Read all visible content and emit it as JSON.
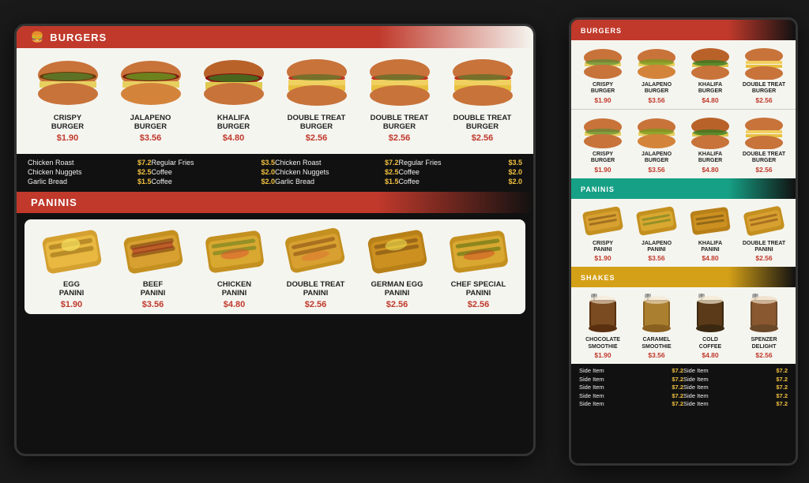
{
  "main_board": {
    "burgers_section": {
      "header": "BURGERS",
      "items": [
        {
          "name": "CRISPY\nBURGER",
          "price": "$1.90",
          "id": "crispy"
        },
        {
          "name": "JALAPENO\nBURGER",
          "price": "$3.56",
          "id": "jalapeno"
        },
        {
          "name": "KHALIFA\nBURGER",
          "price": "$4.80",
          "id": "khalifa"
        },
        {
          "name": "DOUBLE TREAT\nBURGER",
          "price": "$2.56",
          "id": "double1"
        },
        {
          "name": "DOUBLE TREAT\nBURGER",
          "price": "$2.56",
          "id": "double2"
        },
        {
          "name": "DOUBLE TREAT\nBURGER",
          "price": "$2.56",
          "id": "double3"
        }
      ]
    },
    "side_items_left": [
      {
        "name": "Chicken Roast",
        "price": "$7.2"
      },
      {
        "name": "Chicken Nuggets",
        "price": "$2.5"
      },
      {
        "name": "Garlic Bread",
        "price": "$1.5"
      }
    ],
    "side_items_mid": [
      {
        "name": "Regular Fries",
        "price": "$3.5"
      },
      {
        "name": "Coffee",
        "price": "$2.0"
      },
      {
        "name": "Coffee",
        "price": "$2.0"
      }
    ],
    "side_items_right": [
      {
        "name": "Chicken Roast",
        "price": "$7.2"
      },
      {
        "name": "Chicken Nuggets",
        "price": "$2.5"
      },
      {
        "name": "Garlic Bread",
        "price": "$1.5"
      }
    ],
    "side_items_far": [
      {
        "name": "Regular Fries",
        "price": "$3.5"
      },
      {
        "name": "Coffee",
        "price": "$2.0"
      },
      {
        "name": "Coffee",
        "price": "$2.0"
      }
    ],
    "paninis_section": {
      "header": "PANINIS",
      "items": [
        {
          "name": "EGG\nPANINI",
          "price": "$1.90",
          "id": "egg"
        },
        {
          "name": "BEEF\nPANINI",
          "price": "$3.56",
          "id": "beef"
        },
        {
          "name": "CHICKEN\nPANINI",
          "price": "$4.80",
          "id": "chicken"
        },
        {
          "name": "DOUBLE TREAT\nPANINI",
          "price": "$2.56",
          "id": "double_treat"
        },
        {
          "name": "GERMAN EGG\nPANINI",
          "price": "$2.56",
          "id": "german"
        },
        {
          "name": "CHEF SPECIAL\nPANINI",
          "price": "$2.56",
          "id": "chef"
        }
      ]
    }
  },
  "small_board": {
    "burgers_section": {
      "header": "BURGERS",
      "items": [
        {
          "name": "CRISPY\nBURGER",
          "price": "$1.90"
        },
        {
          "name": "JALAPENO\nBURGER",
          "price": "$3.56"
        },
        {
          "name": "KHALIFA\nBURGER",
          "price": "$4.80"
        },
        {
          "name": "DOUBLE TREAT\nBURGER",
          "price": "$2.56"
        }
      ]
    },
    "burgers_section2": {
      "items": [
        {
          "name": "CRISPY\nBURGER",
          "price": "$1.90"
        },
        {
          "name": "JALAPENO\nBURGER",
          "price": "$3.56"
        },
        {
          "name": "KHALIFA\nBURGER",
          "price": "$4.80"
        },
        {
          "name": "DOUBLE TREAT\nBURGER",
          "price": "$2.56"
        }
      ]
    },
    "paninis_section": {
      "header": "PANINIS",
      "items": [
        {
          "name": "CRISPY\nPANINI",
          "price": "$1.90"
        },
        {
          "name": "JALAPENO\nPANINI",
          "price": "$3.56"
        },
        {
          "name": "KHALIFA\nPANINI",
          "price": "$4.80"
        },
        {
          "name": "DOUBLE TREAT\nPANINI",
          "price": "$2.56"
        }
      ]
    },
    "shakes_section": {
      "header": "SHAKES",
      "items": [
        {
          "name": "CHOCOLATE\nSMOOTHIE",
          "price": "$1.90"
        },
        {
          "name": "CARAMEL\nSMOOTHIE",
          "price": "$3.56"
        },
        {
          "name": "COLD\nCOFFEE",
          "price": "$4.80"
        },
        {
          "name": "SPENZER\nDELIGHT",
          "price": "$2.56"
        }
      ]
    },
    "side_items_left": [
      {
        "name": "Side Item",
        "price": "$7.2"
      },
      {
        "name": "Side Item",
        "price": "$7.2"
      },
      {
        "name": "Side Item",
        "price": "$7.2"
      },
      {
        "name": "Side Item",
        "price": "$7.2"
      },
      {
        "name": "Side Item",
        "price": "$7.2"
      }
    ],
    "side_items_right": [
      {
        "name": "Side Item",
        "price": "$7.2"
      },
      {
        "name": "Side Item",
        "price": "$7.2"
      },
      {
        "name": "Side Item",
        "price": "$7.2"
      },
      {
        "name": "Side Item",
        "price": "$7.2"
      },
      {
        "name": "Side Item",
        "price": "$7.2"
      }
    ]
  }
}
